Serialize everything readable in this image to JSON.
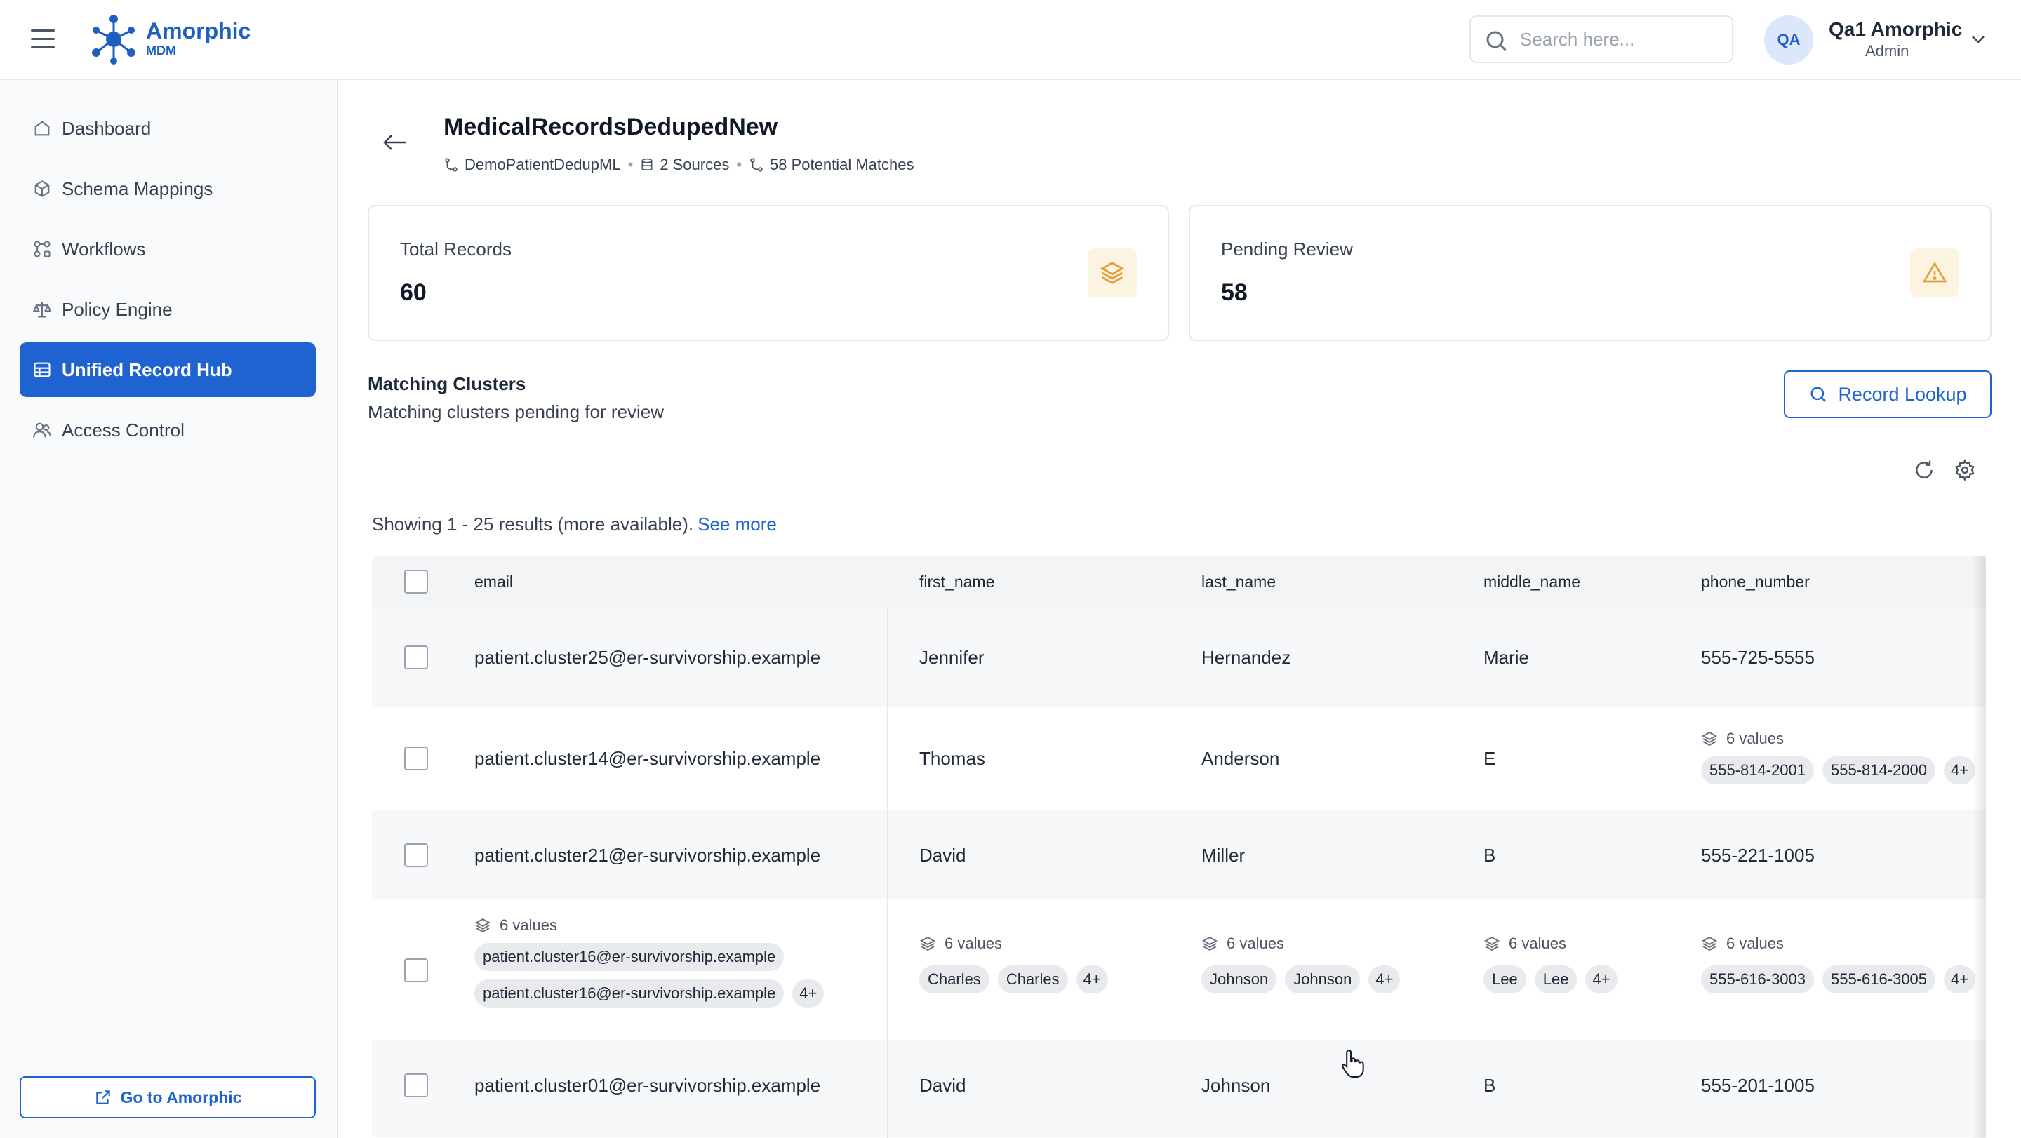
{
  "app": {
    "brand_name": "Amorphic",
    "brand_sub": "MDM"
  },
  "header": {
    "search_placeholder": "Search here...",
    "avatar_initials": "QA",
    "user_name": "Qa1 Amorphic",
    "user_role": "Admin"
  },
  "sidebar": {
    "items": [
      {
        "label": "Dashboard",
        "icon": "home-icon"
      },
      {
        "label": "Schema Mappings",
        "icon": "cube-icon"
      },
      {
        "label": "Workflows",
        "icon": "workflow-icon"
      },
      {
        "label": "Policy Engine",
        "icon": "scale-icon"
      },
      {
        "label": "Unified Record Hub",
        "icon": "table-icon",
        "active": true
      },
      {
        "label": "Access Control",
        "icon": "users-icon"
      }
    ],
    "footer_button": "Go to Amorphic"
  },
  "page": {
    "title": "MedicalRecordsDedupedNew",
    "workflow": "DemoPatientDedupML",
    "sources": "2 Sources",
    "matches": "58 Potential Matches"
  },
  "stats": {
    "total_label": "Total Records",
    "total_value": "60",
    "pending_label": "Pending Review",
    "pending_value": "58"
  },
  "section": {
    "title": "Matching Clusters",
    "subtitle": "Matching clusters pending for review",
    "lookup_button": "Record Lookup",
    "showing_text": "Showing 1 - 25 results (more available).",
    "see_more": "See more"
  },
  "table": {
    "columns": [
      "email",
      "first_name",
      "last_name",
      "middle_name",
      "phone_number"
    ],
    "rows": [
      {
        "email": "patient.cluster25@er-survivorship.example",
        "first_name": "Jennifer",
        "last_name": "Hernandez",
        "middle_name": "Marie",
        "phone_number": "555-725-5555"
      },
      {
        "email": "patient.cluster14@er-survivorship.example",
        "first_name": "Thomas",
        "last_name": "Anderson",
        "middle_name": "E",
        "phone_multi": {
          "count": "6 values",
          "chips": [
            "555-814-2001",
            "555-814-2000"
          ],
          "more": "4+"
        }
      },
      {
        "email": "patient.cluster21@er-survivorship.example",
        "first_name": "David",
        "last_name": "Miller",
        "middle_name": "B",
        "phone_number": "555-221-1005"
      },
      {
        "email_multi": {
          "count": "6 values",
          "chips": [
            "patient.cluster16@er-survivorship.example",
            "patient.cluster16@er-survivorship.example"
          ],
          "more": "4+"
        },
        "first_multi": {
          "count": "6 values",
          "chips": [
            "Charles",
            "Charles"
          ],
          "more": "4+"
        },
        "last_multi": {
          "count": "6 values",
          "chips": [
            "Johnson",
            "Johnson"
          ],
          "more": "4+"
        },
        "middle_multi": {
          "count": "6 values",
          "chips": [
            "Lee",
            "Lee"
          ],
          "more": "4+"
        },
        "phone_multi": {
          "count": "6 values",
          "chips": [
            "555-616-3003",
            "555-616-3005"
          ],
          "more": "4+"
        }
      },
      {
        "email": "patient.cluster01@er-survivorship.example",
        "first_name": "David",
        "last_name": "Johnson",
        "middle_name": "B",
        "phone_number": "555-201-1005"
      }
    ]
  },
  "colors": {
    "primary": "#1e63d0",
    "stat_icon_bg": "#fdf3e1",
    "stat_icon": "#e0a13a"
  }
}
